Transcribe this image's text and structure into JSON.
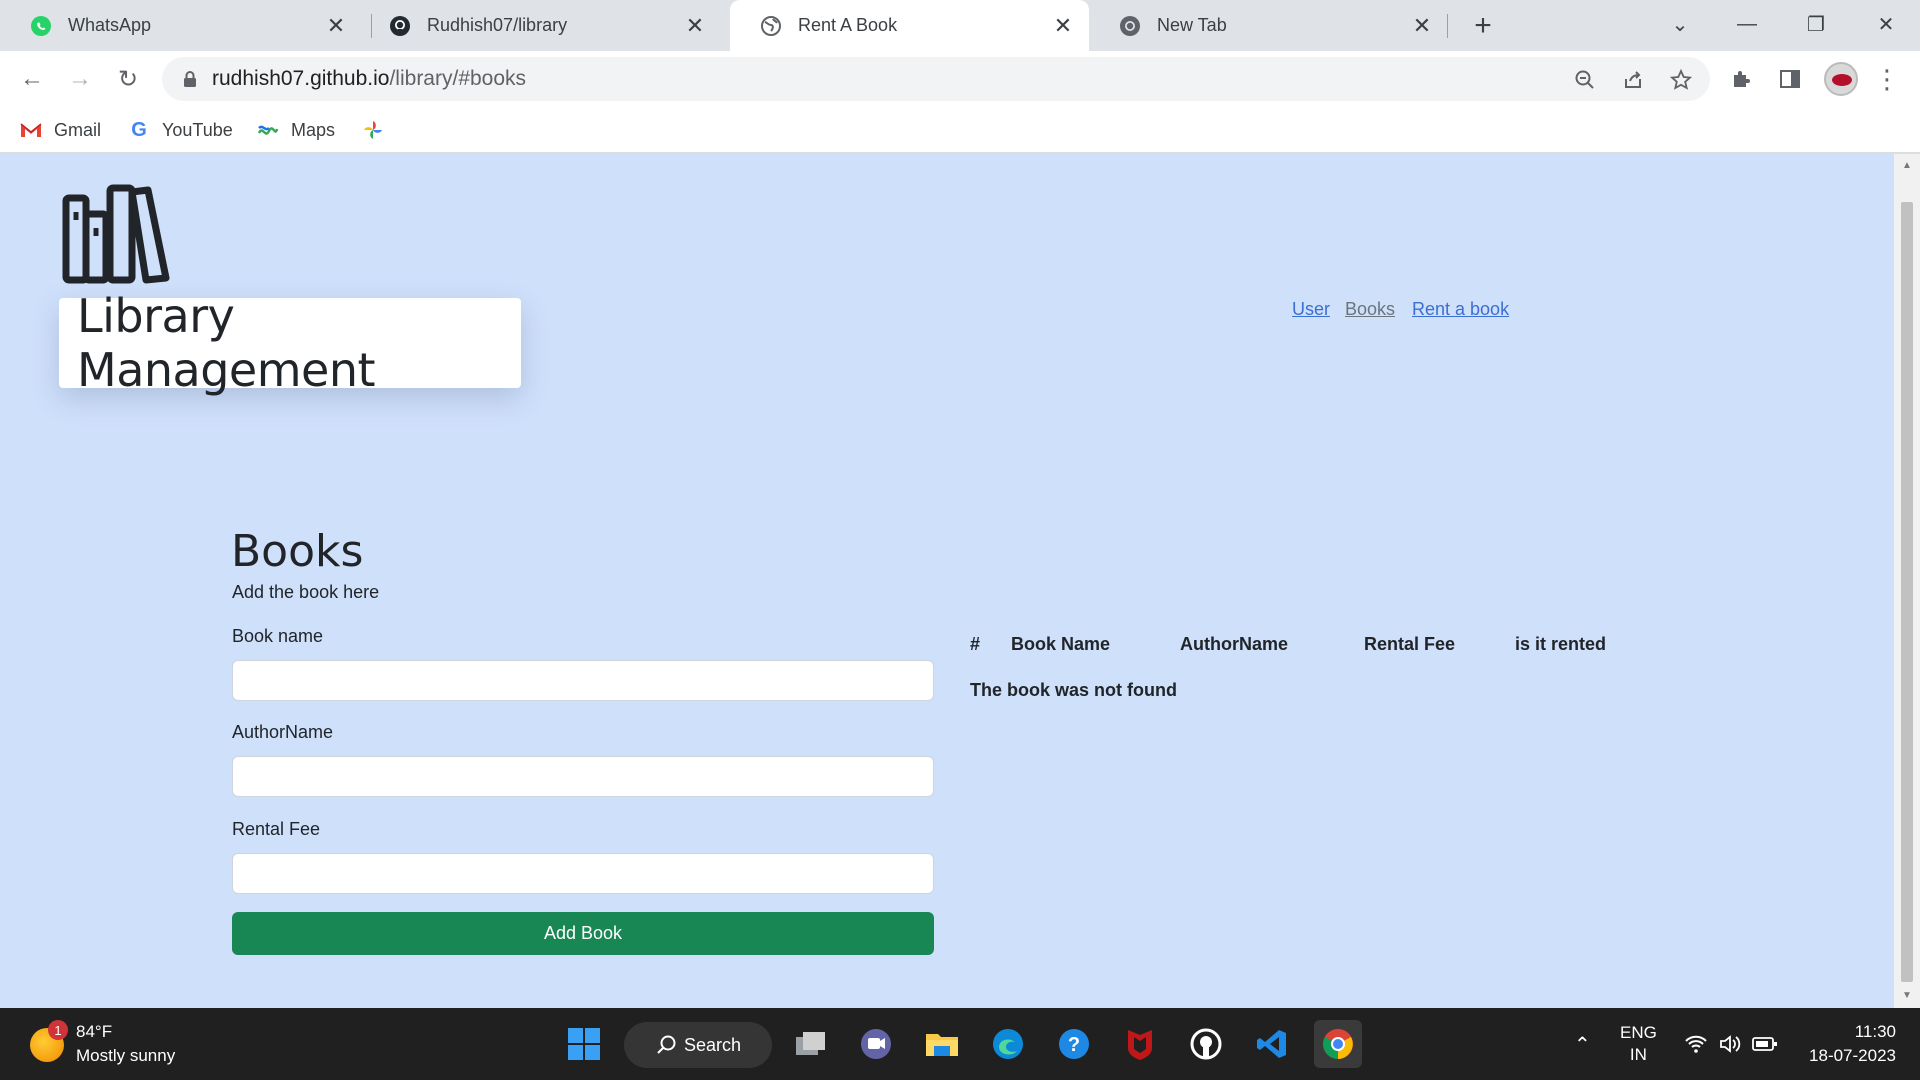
{
  "browser": {
    "tabs": [
      {
        "title": "WhatsApp",
        "icon": "whatsapp-icon",
        "active": false
      },
      {
        "title": "Rudhish07/library",
        "icon": "github-icon",
        "active": false
      },
      {
        "title": "Rent A Book",
        "icon": "globe-icon",
        "active": true
      },
      {
        "title": "New Tab",
        "icon": "chrome-icon",
        "active": false
      }
    ],
    "url_host": "rudhish07.github.io",
    "url_path": "/library/#books",
    "bookmarks": [
      {
        "label": "Gmail",
        "icon": "gmail-icon"
      },
      {
        "label": "YouTube",
        "icon": "google-icon"
      },
      {
        "label": "Maps",
        "icon": "maps-icon"
      },
      {
        "label": "",
        "icon": "photos-icon"
      }
    ]
  },
  "site": {
    "brand": "Library Management",
    "nav": [
      {
        "label": "User",
        "active": false
      },
      {
        "label": "Books",
        "active": true
      },
      {
        "label": "Rent a book",
        "active": false
      }
    ]
  },
  "form": {
    "title": "Books",
    "subtitle": "Add the book here",
    "book_name_label": "Book name",
    "author_label": "AuthorName",
    "fee_label": "Rental Fee",
    "book_name_value": "",
    "author_value": "",
    "fee_value": "",
    "submit_label": "Add Book"
  },
  "table": {
    "headers": [
      "#",
      "Book Name",
      "AuthorName",
      "Rental Fee",
      "is it rented"
    ],
    "empty_message": "The book was not found"
  },
  "taskbar": {
    "weather_temp": "84°F",
    "weather_condition": "Mostly sunny",
    "weather_badge": "1",
    "search_label": "Search",
    "lang_top": "ENG",
    "lang_bottom": "IN",
    "time": "11:30",
    "date": "18-07-2023"
  },
  "colors": {
    "page_bg": "#cfe0fb",
    "link": "#3b6fd1",
    "button_green": "#198754"
  }
}
